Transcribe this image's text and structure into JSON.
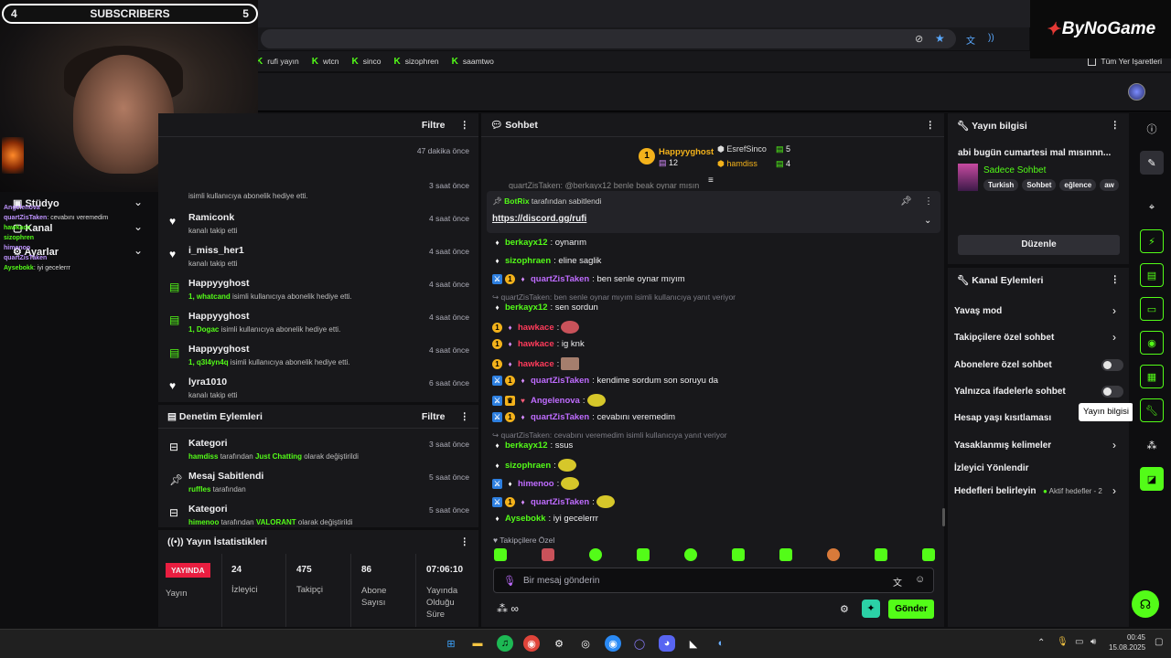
{
  "overlay": {
    "sub_left": "4",
    "sub_title": "SUBSCRIBERS",
    "sub_right": "5",
    "brand": "ByNoGame"
  },
  "browser": {
    "bookmarks": [
      "rufi yayın",
      "wtcn",
      "sinco",
      "sizophren",
      "saamtwo"
    ],
    "all_bookmarks": "Tüm Yer İşaretleri"
  },
  "left_nav": {
    "item1": "Stüdyo",
    "item2": "Kanal",
    "item3": "Ayarlar"
  },
  "mini_chat": [
    {
      "user": "Angelenova",
      "text": ""
    },
    {
      "user": "quartZisTaken",
      "text": "cevabını veremedim"
    },
    {
      "user": "hawkace",
      "text": ""
    },
    {
      "user": "sizophren",
      "text": ""
    },
    {
      "user": "himenoo",
      "text": ""
    },
    {
      "user": "quartZisTaken",
      "text": ""
    },
    {
      "user": "Aysebokk",
      "text": "iyi gecelerrr"
    }
  ],
  "activity": {
    "filter": "Filtre",
    "rows": [
      {
        "title": "",
        "sub_green": "",
        "sub": "",
        "time": "47 dakika önce",
        "icon": "heart"
      },
      {
        "title": "",
        "sub_green": "",
        "sub": "isimli kullanıcıya abonelik hediye etti.",
        "time": "3 saat önce",
        "icon": "gift"
      },
      {
        "title": "Ramiconk",
        "sub_green": "",
        "sub": "kanalı takip etti",
        "time": "4 saat önce",
        "icon": "heart"
      },
      {
        "title": "i_miss_her1",
        "sub_green": "",
        "sub": "kanalı takip etti",
        "time": "4 saat önce",
        "icon": "heart"
      },
      {
        "title": "Happyyghost",
        "sub_green": "1, whatcand",
        "sub": " isimli kullanıcıya abonelik hediye etti.",
        "time": "4 saat önce",
        "icon": "gift"
      },
      {
        "title": "Happyyghost",
        "sub_green": "1, Dogac",
        "sub": " isimli kullanıcıya abonelik hediye etti.",
        "time": "4 saat önce",
        "icon": "gift"
      },
      {
        "title": "Happyyghost",
        "sub_green": "1, q3l4yn4q",
        "sub": " isimli kullanıcıya abonelik hediye etti.",
        "time": "4 saat önce",
        "icon": "gift"
      },
      {
        "title": "lyra1010",
        "sub_green": "",
        "sub": "kanalı takip etti",
        "time": "6 saat önce",
        "icon": "heart"
      }
    ]
  },
  "moderation": {
    "title": "Denetim Eylemleri",
    "filter": "Filtre",
    "rows": [
      {
        "title": "Kategori",
        "sub_green": "hamdiss",
        "sub": " tarafından ",
        "sub_green2": "Just Chatting",
        "sub2": " olarak değiştirildi",
        "time": "3 saat önce"
      },
      {
        "title": "Mesaj Sabitlendi",
        "sub_green": "ruffles",
        "sub": " tarafından",
        "sub_green2": "",
        "sub2": "",
        "time": "5 saat önce"
      },
      {
        "title": "Kategori",
        "sub_green": "himenoo",
        "sub": " tarafından ",
        "sub_green2": "VALORANT",
        "sub2": " olarak değiştirildi",
        "time": "5 saat önce"
      }
    ]
  },
  "stats": {
    "title": "Yayın İstatistikleri",
    "live_badge": "YAYINDA",
    "live_label": "Yayın",
    "viewers": "24",
    "viewers_label": "İzleyici",
    "followers": "475",
    "followers_label": "Takipçi",
    "subs": "86",
    "subs_label": "Abone Sayısı",
    "uptime": "07:06:10",
    "uptime_label": "Yayında Olduğu Süre"
  },
  "chat": {
    "title": "Sohbet",
    "top_gifter": {
      "name": "Happyyghost",
      "count": "12",
      "rank": "1"
    },
    "gifter2": {
      "name": "EsrefSinco",
      "count": "5"
    },
    "gifter3": {
      "name": "hamdiss",
      "count": "4"
    },
    "partial_line": "quartZisTaken: @berkayx12 benle beak oynar mısın",
    "pinned_by_user": "BotRix",
    "pinned_by_suffix": "tarafından sabitlendi",
    "pinned_link": "https://discord.gg/rufi",
    "messages": [
      {
        "user": "berkayx12",
        "color": "#53fc18",
        "text": ": oynarım"
      },
      {
        "user": "sizophraen",
        "color": "#53fc18",
        "text": ": eline saglik"
      },
      {
        "user": "quartZisTaken",
        "color": "#bf6cff",
        "text": ": ben senle oynar mıyım"
      },
      {
        "user": "berkayx12",
        "color": "#53fc18",
        "text": ": sen sordun"
      },
      {
        "user": "hawkace",
        "color": "#ff3b5b",
        "text": ":"
      },
      {
        "user": "hawkace",
        "color": "#ff3b5b",
        "text": ": ig knk"
      },
      {
        "user": "hawkace",
        "color": "#ff3b5b",
        "text": ":"
      },
      {
        "user": "quartZisTaken",
        "color": "#bf6cff",
        "text": ": kendime sordum son soruyu da"
      },
      {
        "user": "Angelenova",
        "color": "#bf6cff",
        "text": ":"
      },
      {
        "user": "quartZisTaken",
        "color": "#bf6cff",
        "text": ": cevabını veremedim"
      },
      {
        "user": "berkayx12",
        "color": "#53fc18",
        "text": ": ssus"
      },
      {
        "user": "sizophraen",
        "color": "#53fc18",
        "text": ":"
      },
      {
        "user": "himenoo",
        "color": "#bf6cff",
        "text": ":"
      },
      {
        "user": "quartZisTaken",
        "color": "#bf6cff",
        "text": ":"
      },
      {
        "user": "Aysebokk",
        "color": "#53fc18",
        "text": ": iyi gecelerrr"
      }
    ],
    "reply1": "quartZisTaken: ben senle oynar mıyım isimli kullanıcıya yanıt veriyor",
    "reply2": "quartZisTaken: cevabını veremedim isimli kullanıcıya yanıt veriyor",
    "followers_only": "Takipçilere Özel",
    "input_placeholder": "Bir mesaj gönderin",
    "send": "Gönder"
  },
  "stream_info": {
    "title": "Yayın bilgisi",
    "stream_title": "abi bugün cumartesi mal mısınnn...",
    "category": "Sadece Sohbet",
    "tags": [
      "Turkish",
      "Sohbet",
      "eğlence",
      "aw"
    ],
    "edit": "Düzenle"
  },
  "channel_actions": {
    "title": "Kanal Eylemleri",
    "items": [
      {
        "label": "Yavaş mod",
        "type": "chevron"
      },
      {
        "label": "Takipçilere özel sohbet",
        "type": "chevron"
      },
      {
        "label": "Abonelere özel sohbet",
        "type": "toggle"
      },
      {
        "label": "Yalnızca ifadelerle sohbet",
        "type": "toggle"
      },
      {
        "label": "Hesap yaşı kısıtlaması",
        "type": "none"
      },
      {
        "label": "Yasaklanmış kelimeler",
        "type": "chevron"
      },
      {
        "label": "İzleyici Yönlendir",
        "type": "none"
      },
      {
        "label": "Hedefleri belirleyin",
        "type": "chevron"
      }
    ],
    "goals_status": "Aktif hedefler - 2"
  },
  "tooltip": "Yayın bilgisi",
  "taskbar": {
    "time": "00:45",
    "date": "15.08.2025"
  }
}
